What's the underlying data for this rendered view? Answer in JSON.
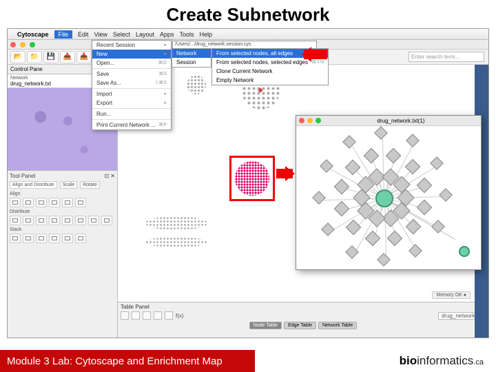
{
  "slide": {
    "title": "Create Subnetwork"
  },
  "mac_menu": {
    "apple": "",
    "app": "Cytoscape",
    "items": [
      "File",
      "Edit",
      "View",
      "Select",
      "Layout",
      "Apps",
      "Tools",
      "Help"
    ],
    "active": "File"
  },
  "file_menu": {
    "recent": "Recent Session",
    "recent_path": "/Users/.../drug_network.session.cys",
    "new": "New",
    "open": "Open...",
    "open_sc": "⌘O",
    "save": "Save",
    "save_sc": "⌘S",
    "saveas": "Save As...",
    "saveas_sc": "⇧⌘S",
    "import": "Import",
    "export": "Export",
    "run": "Run...",
    "print": "Print Current Network ...",
    "print_sc": "⌘P"
  },
  "new_submenu": {
    "network": "Network",
    "session": "Session"
  },
  "network_submenu": {
    "sel_all": "From selected nodes, all edges",
    "sel_sel": "From selected nodes, selected edges",
    "sel_sel_sc": "⌘⇧N",
    "clone": "Clone Current Network",
    "empty": "Empty Network"
  },
  "toolbar_icons": [
    "📂",
    "📁",
    "💾",
    "📤",
    "📥",
    "🔍+",
    "🔍-",
    "🔍",
    "↺"
  ],
  "search_placeholder": "Enter search term...",
  "control_pane": {
    "title": "Control Pane",
    "close": "✕"
  },
  "network_list": {
    "col_network": "Network",
    "item": "drug_network.txt"
  },
  "tool_panel": {
    "title": "Tool Panel",
    "close": "⊡ ✕",
    "tabs": [
      "Align and Distribute",
      "Scale",
      "Rotate"
    ],
    "sec_align": "Align",
    "sec_distribute": "Distribute",
    "sec_stack": "Stack"
  },
  "table_panel": {
    "title": "Table Panel",
    "fx": "f(x)",
    "src": "drug_network.txt",
    "tabs": [
      "Node Table",
      "Edge Table",
      "Network Table"
    ],
    "selected": "Node Table"
  },
  "memory": "Memory OK ●",
  "popup": {
    "title": "drug_network.txt(1)"
  },
  "footer": {
    "module": "Module 3 Lab: Cytoscape and Enrichment Map",
    "brand_bold": "bio",
    "brand_rest": "informatics",
    "brand_tld": ".ca"
  }
}
